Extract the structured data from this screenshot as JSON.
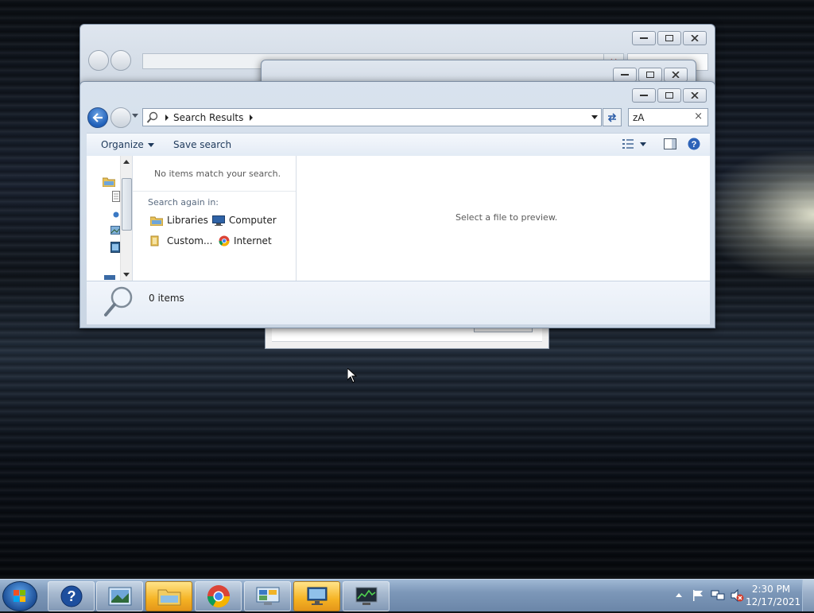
{
  "explorer": {
    "address_crumb": "Search Results",
    "search_value": "zA",
    "toolbar": {
      "organize_label": "Organize",
      "save_search_label": "Save search"
    },
    "results": {
      "no_items_text": "No items match your search.",
      "search_again_label": "Search again in:",
      "locations": [
        "Libraries",
        "Computer",
        "Custom...",
        "Internet"
      ]
    },
    "preview_text": "Select a file to preview.",
    "status_count": "0 items"
  },
  "taskbar": {
    "time": "2:30 PM",
    "date": "12/17/2021",
    "pinned_icons": [
      "help-icon",
      "picture-viewer-icon",
      "file-explorer-icon",
      "chrome-icon",
      "control-panel-icon",
      "remote-desktop-icon",
      "task-manager-icon"
    ]
  }
}
